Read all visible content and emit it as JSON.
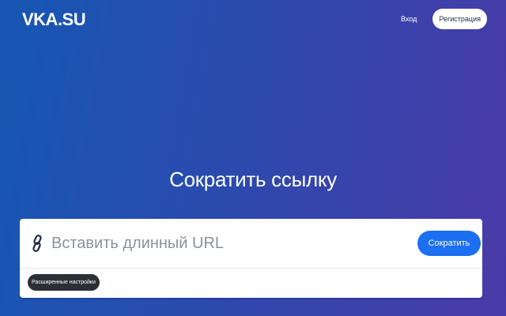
{
  "header": {
    "logo": "VKA.SU",
    "login_label": "Вход",
    "register_label": "Регистрация"
  },
  "hero": {
    "title": "Сократить ссылку"
  },
  "shortener": {
    "url_placeholder": "Вставить длинный URL",
    "url_value": "",
    "submit_label": "Сократить",
    "advanced_label": "Расширенные настройки",
    "link_icon": "link-icon"
  },
  "colors": {
    "accent": "#1b6ff0",
    "gradient_start": "#1657b3",
    "gradient_end": "#4b3aa8",
    "dark_badge": "#2c2f36"
  }
}
